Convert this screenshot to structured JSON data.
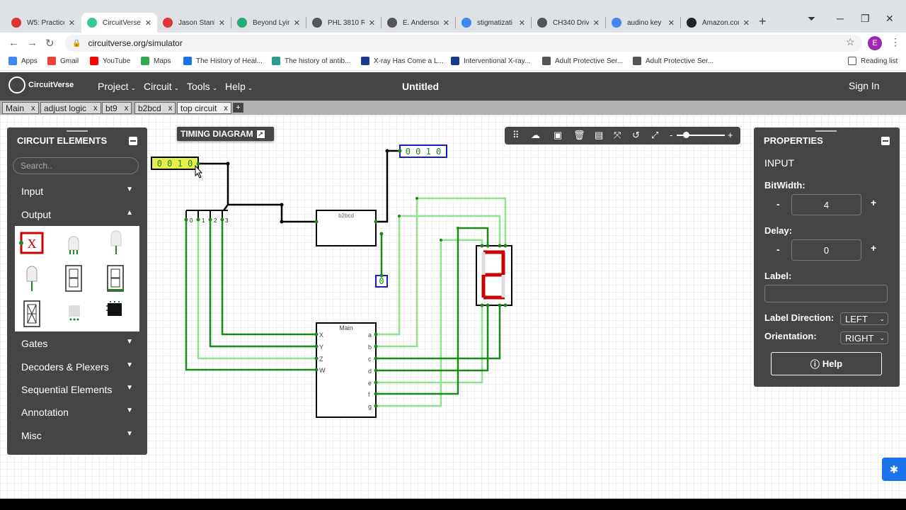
{
  "browser": {
    "tabs": [
      {
        "title": "W5: Practice",
        "favicon_color": "#d33"
      },
      {
        "title": "CircuitVerse",
        "favicon_color": "#3c9"
      },
      {
        "title": "Jason Stank",
        "favicon_color": "#d33"
      },
      {
        "title": "Beyond Lying",
        "favicon_color": "#2a7"
      },
      {
        "title": "PHL 3810 R",
        "favicon_color": "#555"
      },
      {
        "title": "E. Anderson",
        "favicon_color": "#555"
      },
      {
        "title": "stigmatizati",
        "favicon_color": "#4285f4"
      },
      {
        "title": "CH340 Drive",
        "favicon_color": "#555"
      },
      {
        "title": "audino key",
        "favicon_color": "#4285f4"
      },
      {
        "title": "Amazon.com",
        "favicon_color": "#222"
      }
    ],
    "url": "circuitverse.org/simulator",
    "avatar_letter": "E",
    "bookmarks": [
      "Apps",
      "Gmail",
      "YouTube",
      "Maps",
      "The History of Heal...",
      "The history of antib...",
      "X-ray Has Come a L...",
      "Interventional X-ray...",
      "Adult Protective Ser...",
      "Adult Protective Ser..."
    ],
    "reading_list": "Reading list"
  },
  "app": {
    "logo": "CircuitVerse",
    "menus": [
      "Project",
      "Circuit",
      "Tools",
      "Help"
    ],
    "project_title": "Untitled",
    "sign_in": "Sign In",
    "circuit_tabs": [
      "Main",
      "adjust logic",
      "bt9",
      "b2bcd",
      "top circuit"
    ],
    "active_circuit_tab": "top circuit"
  },
  "elements_panel": {
    "title": "CIRCUIT ELEMENTS",
    "search_placeholder": "Search..",
    "categories_top": [
      "Input",
      "Output"
    ],
    "categories_bottom": [
      "Gates",
      "Decoders & Plexers",
      "Sequential Elements",
      "Annotation",
      "Misc"
    ]
  },
  "timing_diagram": "TIMING DIAGRAM",
  "properties": {
    "title": "PROPERTIES",
    "element": "INPUT",
    "bitwidth_label": "BitWidth:",
    "bitwidth": "4",
    "delay_label": "Delay:",
    "delay": "0",
    "label_label": "Label:",
    "label_direction_label": "Label Direction:",
    "label_direction": "LEFT",
    "orientation_label": "Orientation:",
    "orientation": "RIGHT",
    "help": "Help"
  },
  "circuit": {
    "input_value": "0 0 1 0",
    "output_value": "0 0 1 0",
    "small_output": "0",
    "splitter_labels": [
      "0",
      "1",
      "2",
      "3"
    ],
    "subcircuit_b2bcd": "b2bcd",
    "subcircuit_main": "Main",
    "main_inputs": [
      "X",
      "Y",
      "Z",
      "W"
    ],
    "main_outputs": [
      "a",
      "b",
      "c",
      "d",
      "e",
      "f",
      "g"
    ]
  },
  "colors": {
    "nav_bg": "#454545",
    "wire_on": "#1a7a1a",
    "wire_off": "#8fe38f",
    "accent_blue": "#1a1acc",
    "segment_red": "#cc0000"
  }
}
